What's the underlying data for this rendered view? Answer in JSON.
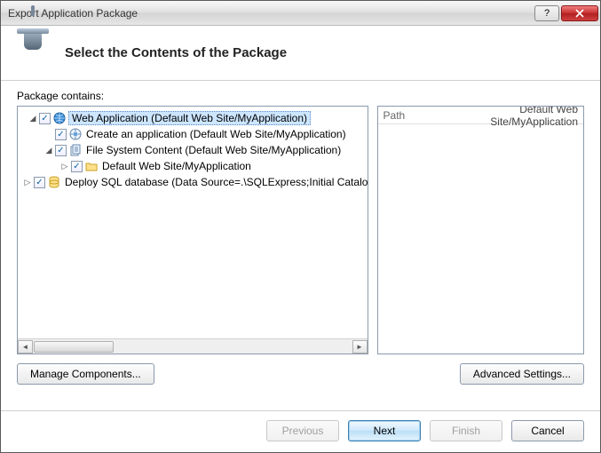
{
  "window": {
    "title": "Export Application Package"
  },
  "header": {
    "text": "Select the Contents of the Package"
  },
  "section_label": "Package contains:",
  "tree": {
    "rows": [
      {
        "level": 0,
        "expander": "open",
        "checked": true,
        "icon": "globe-icon",
        "label": "Web Application (Default Web Site/MyApplication)",
        "selected": true
      },
      {
        "level": 1,
        "expander": "none",
        "checked": true,
        "icon": "app-icon",
        "label": "Create an application (Default Web Site/MyApplication)",
        "selected": false
      },
      {
        "level": 1,
        "expander": "open",
        "checked": true,
        "icon": "docs-icon",
        "label": "File System Content (Default Web Site/MyApplication)",
        "selected": false
      },
      {
        "level": 2,
        "expander": "closed",
        "checked": true,
        "icon": "folder-icon",
        "label": "Default Web Site/MyApplication",
        "selected": false
      },
      {
        "level": 0,
        "expander": "closed",
        "checked": true,
        "icon": "db-icon",
        "label": "Deploy SQL database (Data Source=.\\SQLExpress;Initial Catalog=",
        "selected": false
      }
    ]
  },
  "detail": {
    "key": "Path",
    "value": "Default Web Site/MyApplication"
  },
  "buttons": {
    "manage": "Manage Components...",
    "advanced": "Advanced Settings...",
    "previous": "Previous",
    "next": "Next",
    "finish": "Finish",
    "cancel": "Cancel"
  }
}
